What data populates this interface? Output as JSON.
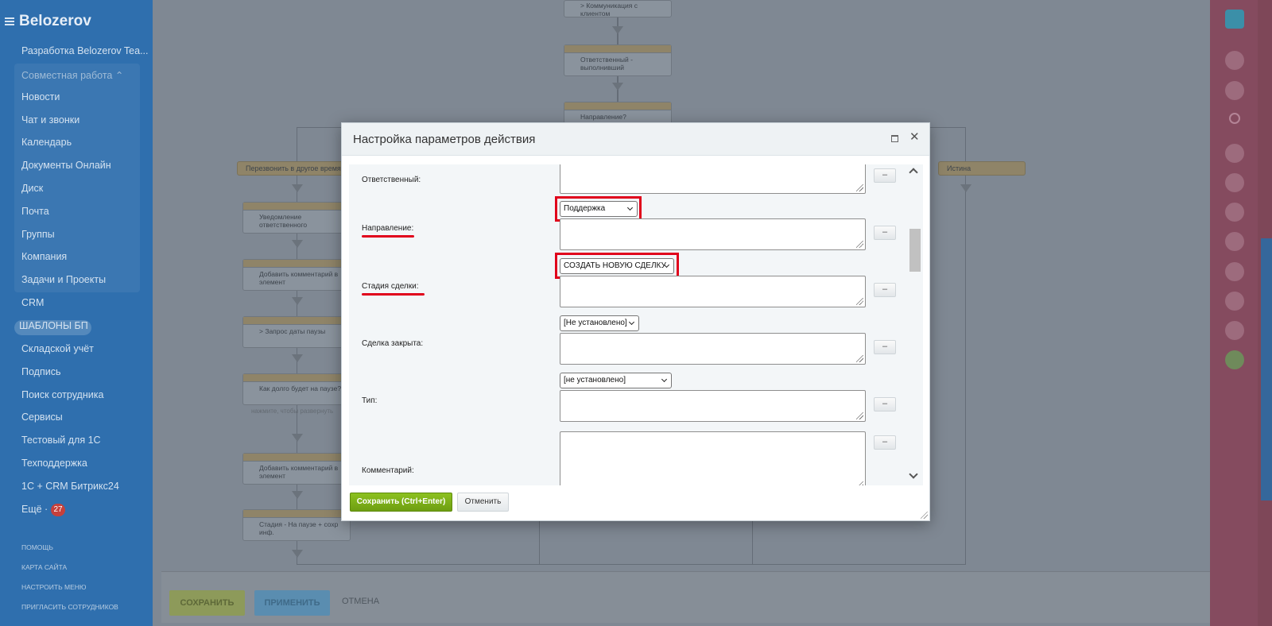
{
  "sidebar": {
    "brand": "Belozerov",
    "items": [
      "Разработка Belozerov Tea...",
      "Совместная работа ⌃",
      "Новости",
      "Чат и звонки",
      "Календарь",
      "Документы Онлайн",
      "Диск",
      "Почта",
      "Группы",
      "Компания",
      "Задачи и Проекты",
      "CRM",
      "ШАБЛОНЫ БП",
      "Складской учёт",
      "Подпись",
      "Поиск сотрудника",
      "Сервисы",
      "Тестовый для 1С",
      "Техподдержка",
      "1С + CRM Битрикс24",
      "Ещё ·"
    ],
    "more_badge": "27",
    "footer_links": [
      "ПОМОЩЬ",
      "КАРТА САЙТА",
      "НАСТРОИТЬ МЕНЮ",
      "ПРИГЛАСИТЬ СОТРУДНИКОВ"
    ]
  },
  "workflow": {
    "blocks": [
      "> Коммуникация с клиентом",
      "Ответственный - выполнивший",
      "Направление?",
      "Уведомление ответственного",
      "Добавить комментарий в элемент",
      "> Запрос даты паузы",
      "Как долго будет на паузе?",
      "Добавить комментарий в элемент",
      "Стадия - На паузе + сохр инф."
    ],
    "branch_left": "Перезвонить в другое время",
    "branch_right": "Истина",
    "hint": "нажмите, чтобы развернуть"
  },
  "bottom_bar": {
    "save": "СОХРАНИТЬ",
    "apply": "ПРИМЕНИТЬ",
    "cancel": "ОТМЕНА"
  },
  "modal": {
    "title": "Настройка параметров действия",
    "fields": {
      "responsible": "Ответственный:",
      "direction": "Направление:",
      "deal_stage": "Стадия сделки:",
      "deal_closed": "Сделка закрыта:",
      "type": "Тип:",
      "comment": "Комментарий:"
    },
    "selects": {
      "direction": "Поддержка",
      "deal_stage": "СОЗДАТЬ НОВУЮ СДЕЛКУ",
      "deal_closed": "[Не установлено]",
      "type": "[не установлено]"
    },
    "dash": "–",
    "save": "Сохранить (Ctrl+Enter)",
    "cancel": "Отменить"
  },
  "colors": {
    "highlight": "#e0001b",
    "save_button": "#7cb116",
    "sidebar": "#2f6fae"
  }
}
